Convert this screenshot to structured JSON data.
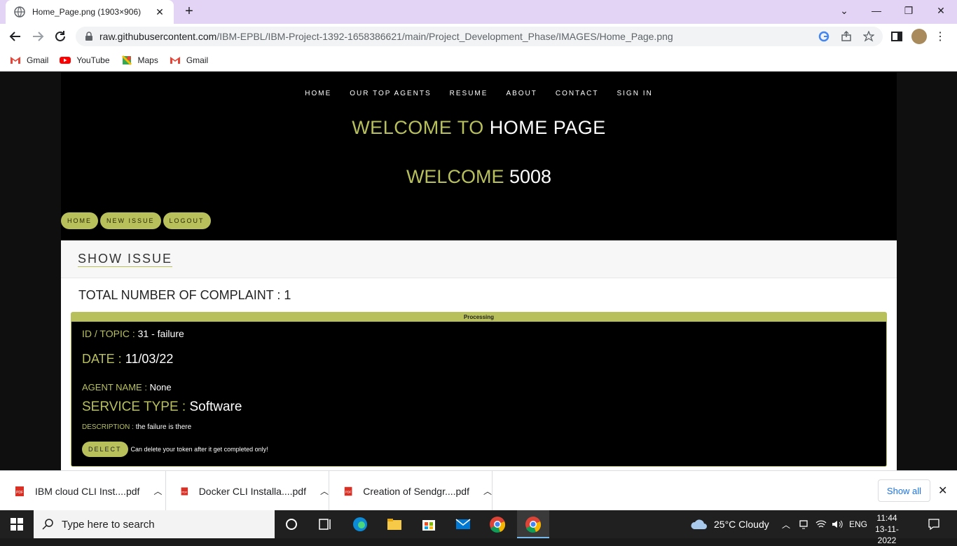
{
  "browser": {
    "tab_title": "Home_Page.png (1903×906)",
    "url_host": "raw.githubusercontent.com",
    "url_path": "/IBM-EPBL/IBM-Project-1392-1658386621/main/Project_Development_Phase/IMAGES/Home_Page.png",
    "bookmarks": [
      "Gmail",
      "YouTube",
      "Maps",
      "Gmail"
    ]
  },
  "site": {
    "nav": [
      "HOME",
      "OUR TOP AGENTS",
      "RESUME",
      "ABOUT",
      "CONTACT",
      "SIGN IN"
    ],
    "hero_prefix": "WELCOME TO",
    "hero_suffix": "HOME PAGE",
    "welcome_prefix": "WELCOME",
    "welcome_user": "5008",
    "pills": [
      "HOME",
      "NEW ISSUE",
      "LOGOUT"
    ],
    "card_title": "SHOW ISSUE",
    "total_label": "TOTAL NUMBER OF COMPLAINT : ",
    "total_value": "1",
    "issue": {
      "status": "Processing",
      "id_label": "ID / TOPIC : ",
      "id_value": "31 - failure",
      "date_label": "DATE : ",
      "date_value": "11/03/22",
      "agent_label": "AGENT NAME : ",
      "agent_value": "None",
      "service_label": "SERVICE TYPE : ",
      "service_value": "Software",
      "desc_label": "DESCRIPTION : ",
      "desc_value": "the failure is there",
      "delect_label": "DELECT",
      "delect_note": "Can delete your token after it get completed only!"
    }
  },
  "downloads": {
    "items": [
      "IBM cloud CLI Inst....pdf",
      "Docker CLI Installa....pdf",
      "Creation of Sendgr....pdf"
    ],
    "show_all": "Show all"
  },
  "taskbar": {
    "search_placeholder": "Type here to search",
    "weather": "25°C  Cloudy",
    "lang": "ENG",
    "time": "11:44",
    "date": "13-11-2022"
  },
  "colors": {
    "accent": "#b8c05b",
    "tab_strip": "#e3d3f4",
    "page_bg": "#000000"
  }
}
